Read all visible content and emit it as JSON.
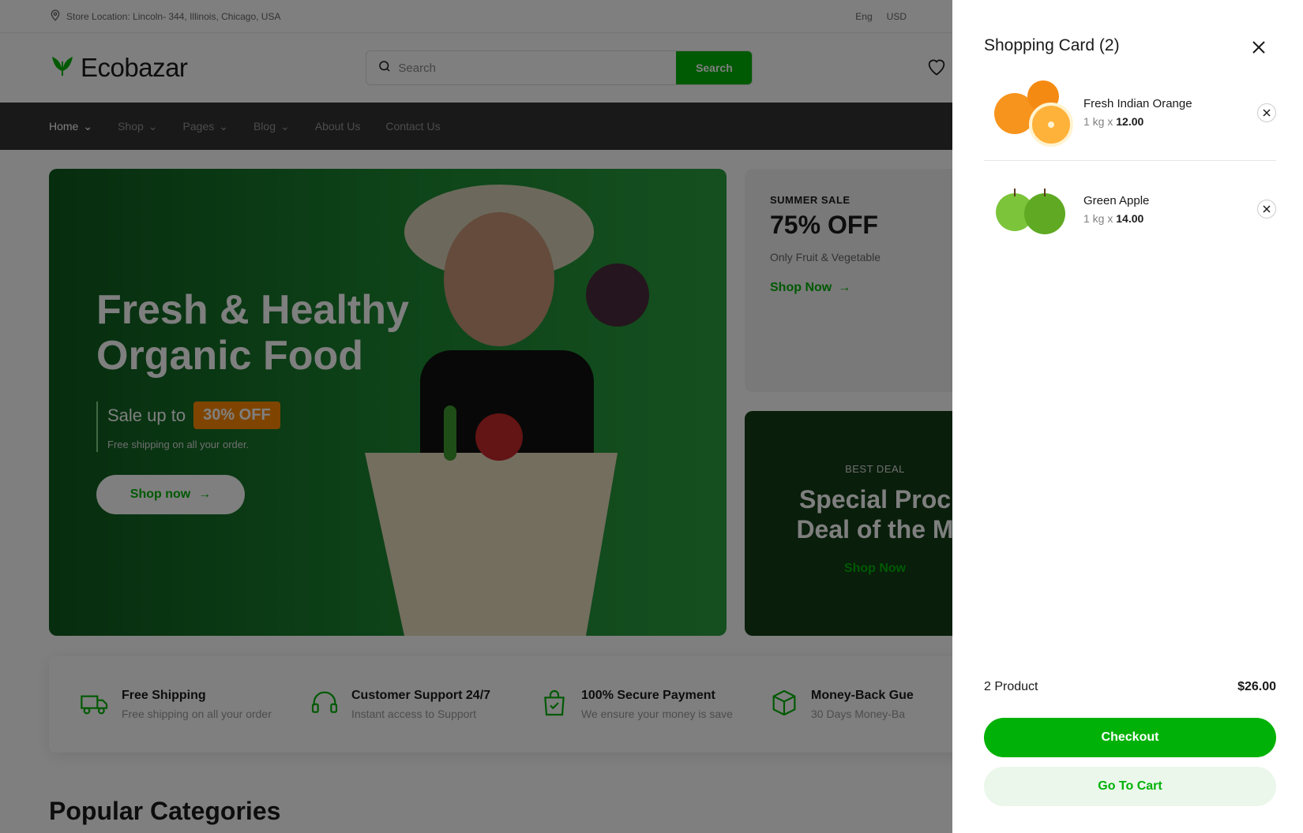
{
  "topbar": {
    "location": "Store Location: Lincoln- 344, Illinois, Chicago, USA",
    "language": "Eng",
    "currency": "USD"
  },
  "header": {
    "logo_text": "Ecobazar",
    "search_placeholder": "Search",
    "search_button": "Search"
  },
  "nav": {
    "items": [
      {
        "label": "Home"
      },
      {
        "label": "Shop"
      },
      {
        "label": "Pages"
      },
      {
        "label": "Blog"
      },
      {
        "label": "About Us"
      },
      {
        "label": "Contact Us"
      }
    ]
  },
  "hero": {
    "title": "Fresh & Healthy Organic Food",
    "sale_prefix": "Sale up to",
    "sale_badge": "30% OFF",
    "sale_sub": "Free shipping on all your order.",
    "cta": "Shop now"
  },
  "promo1": {
    "kicker": "SUMMER SALE",
    "headline": "75% OFF",
    "sub": "Only Fruit & Vegetable",
    "cta": "Shop Now"
  },
  "promo2": {
    "kicker": "BEST DEAL",
    "headline_line1": "Special Proc",
    "headline_line2": "Deal of the M",
    "cta": "Shop Now"
  },
  "features": [
    {
      "title": "Free Shipping",
      "sub": "Free shipping on all your order"
    },
    {
      "title": "Customer Support 24/7",
      "sub": "Instant access to Support"
    },
    {
      "title": "100% Secure Payment",
      "sub": "We ensure your money is save"
    },
    {
      "title": "Money-Back Gue",
      "sub": "30 Days Money-Ba"
    }
  ],
  "popular_title": "Popular Categories",
  "cart": {
    "title": "Shopping Card (2)",
    "items": [
      {
        "name": "Fresh Indian Orange",
        "qty": "1 kg x",
        "price": "12.00"
      },
      {
        "name": "Green Apple",
        "qty": "1 kg x",
        "price": "14.00"
      }
    ],
    "product_count": "2 Product",
    "total": "$26.00",
    "checkout": "Checkout",
    "go_to_cart": "Go To Cart"
  },
  "colors": {
    "brand_green": "#00b207",
    "accent_orange": "#ff8a00"
  }
}
